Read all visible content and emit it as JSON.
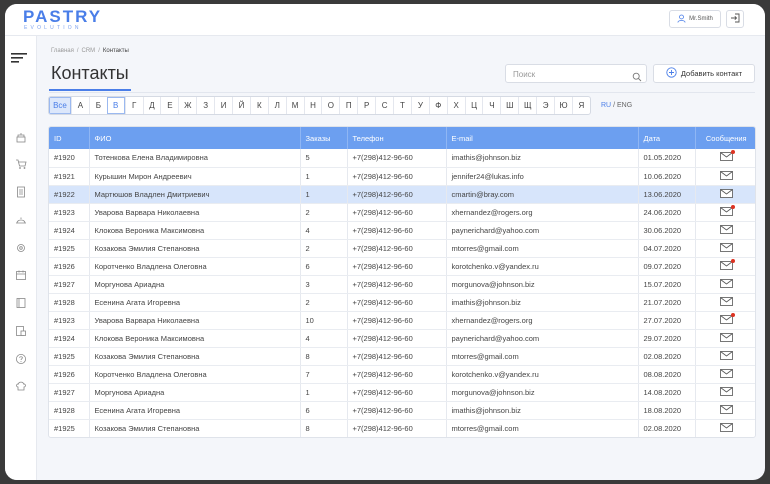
{
  "app": {
    "logo": "PASTRY",
    "logo_sub": "EVOLUTION"
  },
  "header": {
    "user_name": "Mr.Smith"
  },
  "breadcrumb": [
    "Главная",
    "CRM",
    "Контакты"
  ],
  "page": {
    "title": "Контакты"
  },
  "search": {
    "placeholder": "Поиск"
  },
  "add_button": {
    "label": "Добавить контакт"
  },
  "alphabet": [
    "Все",
    "А",
    "Б",
    "В",
    "Г",
    "Д",
    "Е",
    "Ж",
    "З",
    "И",
    "Й",
    "К",
    "Л",
    "М",
    "Н",
    "О",
    "П",
    "Р",
    "С",
    "Т",
    "У",
    "Ф",
    "Х",
    "Ц",
    "Ч",
    "Ш",
    "Щ",
    "Э",
    "Ю",
    "Я"
  ],
  "alphabet_active": "В",
  "lang": {
    "ru": "RU",
    "sep": "/",
    "eng": "ENG"
  },
  "colors": {
    "accent": "#4a7ee8",
    "header": "#6c9ff0",
    "highlight": "#d7e5fb",
    "badge": "#dd3322"
  },
  "table": {
    "columns": [
      "ID",
      "ФИО",
      "Заказы",
      "Телефон",
      "E-mail",
      "Дата",
      "Сообщения"
    ],
    "rows": [
      {
        "id": "#1920",
        "name": "Тотенкова Елена Владимировна",
        "orders": "5",
        "phone": "+7(298)412-96-60",
        "email": "imathis@johnson.biz",
        "date": "01.05.2020",
        "unread": true,
        "highlight": false
      },
      {
        "id": "#1921",
        "name": "Курышин Мирон Андреевич",
        "orders": "1",
        "phone": "+7(298)412-96-60",
        "email": "jennifer24@lukas.info",
        "date": "10.06.2020",
        "unread": false,
        "highlight": false
      },
      {
        "id": "#1922",
        "name": "Мартюшов Владлен Дмитриевич",
        "orders": "1",
        "phone": "+7(298)412-96-60",
        "email": "cmartin@bray.com",
        "date": "13.06.2020",
        "unread": false,
        "highlight": true
      },
      {
        "id": "#1923",
        "name": "Уварова Варвара Николаевна",
        "orders": "2",
        "phone": "+7(298)412-96-60",
        "email": "xhernandez@rogers.org",
        "date": "24.06.2020",
        "unread": true,
        "highlight": false
      },
      {
        "id": "#1924",
        "name": "Клокова Вероника Максимовна",
        "orders": "4",
        "phone": "+7(298)412-96-60",
        "email": "paynerichard@yahoo.com",
        "date": "30.06.2020",
        "unread": false,
        "highlight": false
      },
      {
        "id": "#1925",
        "name": "Козакова Эмилия Степановна",
        "orders": "2",
        "phone": "+7(298)412-96-60",
        "email": "mtorres@gmail.com",
        "date": "04.07.2020",
        "unread": false,
        "highlight": false
      },
      {
        "id": "#1926",
        "name": "Коротченко Владлена Олеговна",
        "orders": "6",
        "phone": "+7(298)412-96-60",
        "email": "korotchenko.v@yandex.ru",
        "date": "09.07.2020",
        "unread": true,
        "highlight": false
      },
      {
        "id": "#1927",
        "name": "Моргунова Ариадна",
        "orders": "3",
        "phone": "+7(298)412-96-60",
        "email": "morgunova@johnson.biz",
        "date": "15.07.2020",
        "unread": false,
        "highlight": false
      },
      {
        "id": "#1928",
        "name": "Есенина Агата Игоревна",
        "orders": "2",
        "phone": "+7(298)412-96-60",
        "email": "imathis@johnson.biz",
        "date": "21.07.2020",
        "unread": false,
        "highlight": false
      },
      {
        "id": "#1923",
        "name": "Уварова Варвара Николаевна",
        "orders": "10",
        "phone": "+7(298)412-96-60",
        "email": "xhernandez@rogers.org",
        "date": "27.07.2020",
        "unread": true,
        "highlight": false
      },
      {
        "id": "#1924",
        "name": "Клокова Вероника Максимовна",
        "orders": "4",
        "phone": "+7(298)412-96-60",
        "email": "paynerichard@yahoo.com",
        "date": "29.07.2020",
        "unread": false,
        "highlight": false
      },
      {
        "id": "#1925",
        "name": "Козакова Эмилия Степановна",
        "orders": "8",
        "phone": "+7(298)412-96-60",
        "email": "mtorres@gmail.com",
        "date": "02.08.2020",
        "unread": false,
        "highlight": false
      },
      {
        "id": "#1926",
        "name": "Коротченко Владлена Олеговна",
        "orders": "7",
        "phone": "+7(298)412-96-60",
        "email": "korotchenko.v@yandex.ru",
        "date": "08.08.2020",
        "unread": false,
        "highlight": false
      },
      {
        "id": "#1927",
        "name": "Моргунова Ариадна",
        "orders": "1",
        "phone": "+7(298)412-96-60",
        "email": "morgunova@johnson.biz",
        "date": "14.08.2020",
        "unread": false,
        "highlight": false
      },
      {
        "id": "#1928",
        "name": "Есенина Агата Игоревна",
        "orders": "6",
        "phone": "+7(298)412-96-60",
        "email": "imathis@johnson.biz",
        "date": "18.08.2020",
        "unread": false,
        "highlight": false
      },
      {
        "id": "#1925",
        "name": "Козакова Эмилия Степановна",
        "orders": "8",
        "phone": "+7(298)412-96-60",
        "email": "mtorres@gmail.com",
        "date": "02.08.2020",
        "unread": false,
        "highlight": false
      }
    ]
  },
  "sidebar": {
    "icons": [
      "menu-icon",
      "cake-icon",
      "cart-icon",
      "document-icon",
      "delivery-icon",
      "settings-icon",
      "calendar-icon",
      "book-icon",
      "report-icon",
      "help-icon",
      "chef-icon"
    ]
  }
}
